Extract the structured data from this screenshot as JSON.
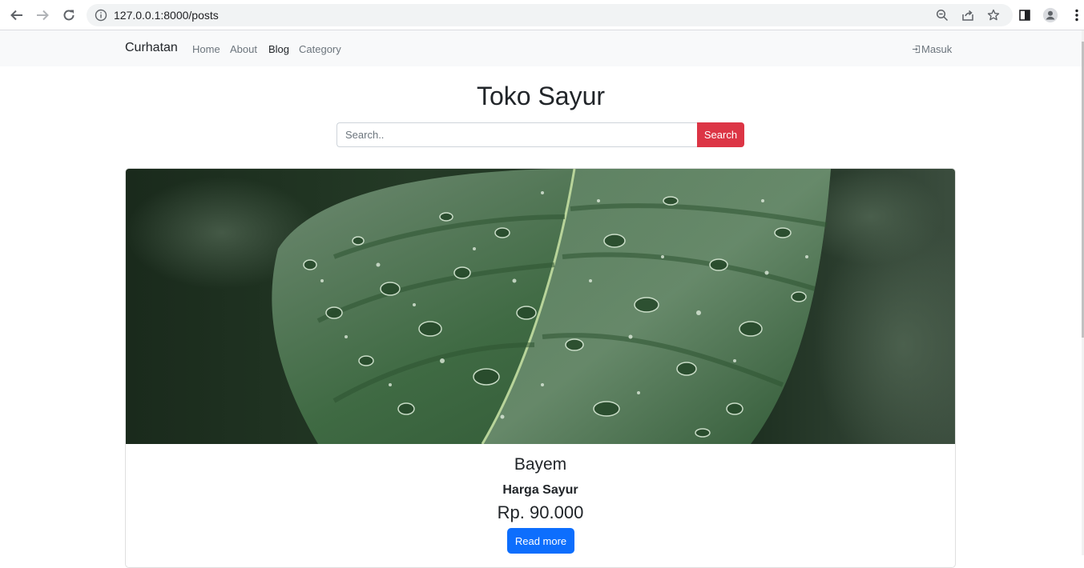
{
  "browser": {
    "url": "127.0.0.1:8000/posts"
  },
  "navbar": {
    "brand": "Curhatan",
    "links": [
      {
        "label": "Home",
        "active": false
      },
      {
        "label": "About",
        "active": false
      },
      {
        "label": "Blog",
        "active": true
      },
      {
        "label": "Category",
        "active": false
      }
    ],
    "login_label": "Masuk"
  },
  "main": {
    "title": "Toko Sayur",
    "search": {
      "placeholder": "Search..",
      "value": "",
      "button_label": "Search"
    },
    "card": {
      "image_subject": "green-leaf-with-water-droplets",
      "title": "Bayem",
      "subtitle": "Harga Sayur",
      "price": "Rp. 90.000",
      "button_label": "Read more"
    }
  },
  "colors": {
    "search_button": "#dc3545",
    "read_more_button": "#0d6efd",
    "navbar_bg": "#f8f9fa"
  }
}
